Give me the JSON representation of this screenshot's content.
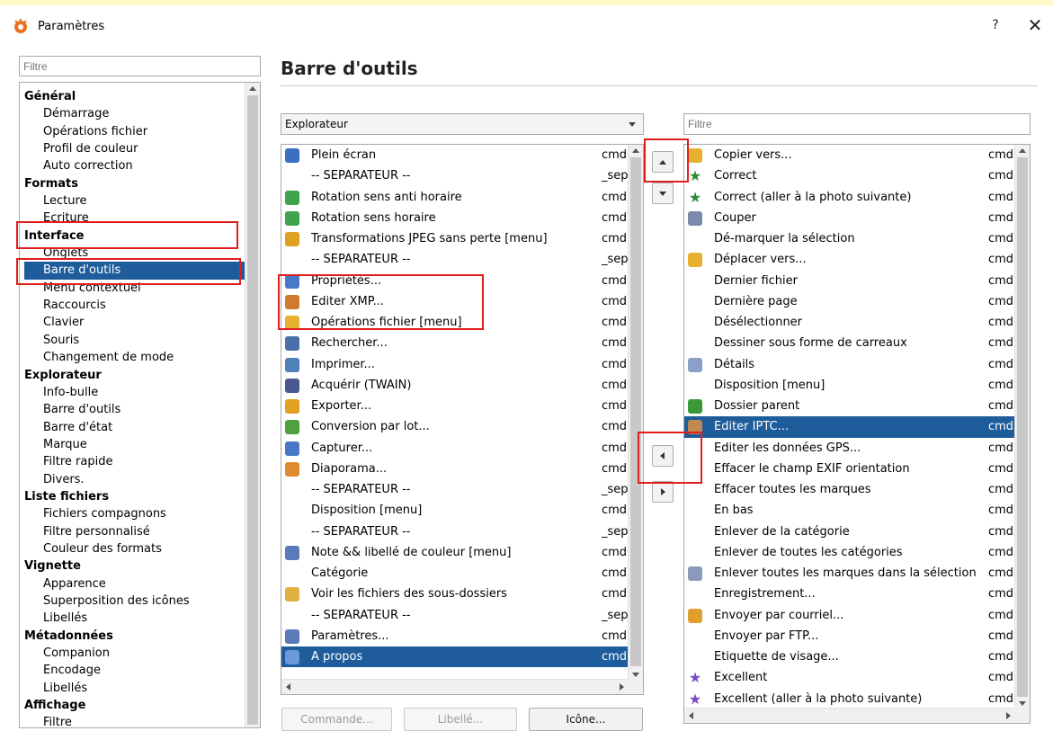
{
  "window": {
    "title": "Paramètres",
    "help": "?",
    "close": "✕"
  },
  "left_filter": {
    "placeholder": "Filtre"
  },
  "tree": [
    {
      "label": "Général",
      "level": 0
    },
    {
      "label": "Démarrage",
      "level": 1
    },
    {
      "label": "Opérations fichier",
      "level": 1
    },
    {
      "label": "Profil de couleur",
      "level": 1
    },
    {
      "label": "Auto correction",
      "level": 1
    },
    {
      "label": "Formats",
      "level": 0
    },
    {
      "label": "Lecture",
      "level": 1
    },
    {
      "label": "Ecriture",
      "level": 1
    },
    {
      "label": "Interface",
      "level": 0
    },
    {
      "label": "Onglets",
      "level": 1
    },
    {
      "label": "Barre d'outils",
      "level": 1,
      "selected": true
    },
    {
      "label": "Menu contextuel",
      "level": 1
    },
    {
      "label": "Raccourcis",
      "level": 1
    },
    {
      "label": "Clavier",
      "level": 1
    },
    {
      "label": "Souris",
      "level": 1
    },
    {
      "label": "Changement de mode",
      "level": 1
    },
    {
      "label": "Explorateur",
      "level": 0
    },
    {
      "label": "Info-bulle",
      "level": 1
    },
    {
      "label": "Barre d'outils",
      "level": 1
    },
    {
      "label": "Barre d'état",
      "level": 1
    },
    {
      "label": "Marque",
      "level": 1
    },
    {
      "label": "Filtre rapide",
      "level": 1
    },
    {
      "label": "Divers.",
      "level": 1
    },
    {
      "label": "Liste fichiers",
      "level": 0
    },
    {
      "label": "Fichiers compagnons",
      "level": 1
    },
    {
      "label": "Filtre personnalisé",
      "level": 1
    },
    {
      "label": "Couleur des formats",
      "level": 1
    },
    {
      "label": "Vignette",
      "level": 0
    },
    {
      "label": "Apparence",
      "level": 1
    },
    {
      "label": "Superposition des icônes",
      "level": 1
    },
    {
      "label": "Libellés",
      "level": 1
    },
    {
      "label": "Métadonnées",
      "level": 0
    },
    {
      "label": "Companion",
      "level": 1
    },
    {
      "label": "Encodage",
      "level": 1
    },
    {
      "label": "Libellés",
      "level": 1
    },
    {
      "label": "Affichage",
      "level": 0
    },
    {
      "label": "Filtre",
      "level": 1
    }
  ],
  "page_title": "Barre d'outils",
  "toolbar_combo": {
    "value": "Explorateur"
  },
  "right_filter": {
    "placeholder": "Filtre"
  },
  "left_list": [
    {
      "label": "Plein écran",
      "cmd": "cmd",
      "icon": "fullscreen-icon",
      "color": "#3a6fc4"
    },
    {
      "label": "-- SEPARATEUR --",
      "cmd": "_sep",
      "icon": ""
    },
    {
      "label": "Rotation sens anti horaire",
      "cmd": "cmd",
      "icon": "rotate-ccw-icon",
      "color": "#3fa34d"
    },
    {
      "label": "Rotation sens horaire",
      "cmd": "cmd",
      "icon": "rotate-cw-icon",
      "color": "#3fa34d"
    },
    {
      "label": "Transformations JPEG sans perte [menu]",
      "cmd": "cmd",
      "icon": "jpeg-transform-icon",
      "color": "#e0a020"
    },
    {
      "label": "-- SEPARATEUR --",
      "cmd": "_sep",
      "icon": ""
    },
    {
      "label": "Propriétés...",
      "cmd": "cmd",
      "icon": "properties-icon",
      "color": "#4a78c8"
    },
    {
      "label": "Editer XMP...",
      "cmd": "cmd",
      "icon": "edit-xmp-icon",
      "color": "#d07a30"
    },
    {
      "label": "Opérations fichier [menu]",
      "cmd": "cmd",
      "icon": "file-operations-icon",
      "color": "#e8b030"
    },
    {
      "label": "Rechercher...",
      "cmd": "cmd",
      "icon": "binoculars-icon",
      "color": "#4a6ea8"
    },
    {
      "label": "Imprimer...",
      "cmd": "cmd",
      "icon": "printer-icon",
      "color": "#5080b8"
    },
    {
      "label": "Acquérir (TWAIN)",
      "cmd": "cmd",
      "icon": "scanner-icon",
      "color": "#4a5a90"
    },
    {
      "label": "Exporter...",
      "cmd": "cmd",
      "icon": "export-icon",
      "color": "#e0a020"
    },
    {
      "label": "Conversion par lot...",
      "cmd": "cmd",
      "icon": "batch-convert-icon",
      "color": "#50a040"
    },
    {
      "label": "Capturer...",
      "cmd": "cmd",
      "icon": "camera-icon",
      "color": "#4a78c8"
    },
    {
      "label": "Diaporama...",
      "cmd": "cmd",
      "icon": "slideshow-icon",
      "color": "#e08a30"
    },
    {
      "label": "-- SEPARATEUR --",
      "cmd": "_sep",
      "icon": ""
    },
    {
      "label": "Disposition [menu]",
      "cmd": "cmd",
      "icon": ""
    },
    {
      "label": "-- SEPARATEUR --",
      "cmd": "_sep",
      "icon": ""
    },
    {
      "label": "Note && libellé de couleur [menu]",
      "cmd": "cmd",
      "icon": "rating-label-icon",
      "color": "#5a7ab8"
    },
    {
      "label": "Catégorie",
      "cmd": "cmd",
      "icon": ""
    },
    {
      "label": "Voir les fichiers des sous-dossiers",
      "cmd": "cmd",
      "icon": "subfolders-icon",
      "color": "#e0b040"
    },
    {
      "label": "-- SEPARATEUR --",
      "cmd": "_sep",
      "icon": ""
    },
    {
      "label": "Paramètres...",
      "cmd": "cmd",
      "icon": "gear-icon",
      "color": "#5a7ab8"
    },
    {
      "label": "A propos",
      "cmd": "cmd",
      "icon": "help-icon",
      "color": "#6a9ad8",
      "selected": true
    }
  ],
  "right_list": [
    {
      "label": "Copier vers...",
      "cmd": "cmd",
      "icon": "copy-to-folder-icon",
      "color": "#e8b030"
    },
    {
      "label": "Correct",
      "cmd": "cmd",
      "icon": "star-green-icon",
      "color": "#2e8b3a"
    },
    {
      "label": "Correct (aller à la photo suivante)",
      "cmd": "cmd",
      "icon": "star-green-next-icon",
      "color": "#2e8b3a"
    },
    {
      "label": "Couper",
      "cmd": "cmd",
      "icon": "scissors-icon",
      "color": "#7a8aa8"
    },
    {
      "label": "Dé-marquer la sélection",
      "cmd": "cmd",
      "icon": ""
    },
    {
      "label": "Déplacer vers...",
      "cmd": "cmd",
      "icon": "move-to-folder-icon",
      "color": "#e8b030"
    },
    {
      "label": "Dernier fichier",
      "cmd": "cmd",
      "icon": ""
    },
    {
      "label": "Dernière page",
      "cmd": "cmd",
      "icon": ""
    },
    {
      "label": "Désélectionner",
      "cmd": "cmd",
      "icon": ""
    },
    {
      "label": "Dessiner sous forme de carreaux",
      "cmd": "cmd",
      "icon": ""
    },
    {
      "label": "Détails",
      "cmd": "cmd",
      "icon": "details-view-icon",
      "color": "#8aa0c8"
    },
    {
      "label": "Disposition [menu]",
      "cmd": "cmd",
      "icon": ""
    },
    {
      "label": "Dossier parent",
      "cmd": "cmd",
      "icon": "up-arrow-green-icon",
      "color": "#3a9a3a"
    },
    {
      "label": "Editer IPTC...",
      "cmd": "cmd",
      "icon": "edit-iptc-icon",
      "color": "#c08a50",
      "selected": true
    },
    {
      "label": "Editer les données GPS...",
      "cmd": "cmd",
      "icon": ""
    },
    {
      "label": "Effacer le champ EXIF orientation",
      "cmd": "cmd",
      "icon": ""
    },
    {
      "label": "Effacer toutes les marques",
      "cmd": "cmd",
      "icon": ""
    },
    {
      "label": "En bas",
      "cmd": "cmd",
      "icon": ""
    },
    {
      "label": "Enlever de la catégorie",
      "cmd": "cmd",
      "icon": ""
    },
    {
      "label": "Enlever de toutes les catégories",
      "cmd": "cmd",
      "icon": ""
    },
    {
      "label": "Enlever toutes les marques dans la sélection",
      "cmd": "cmd",
      "icon": "clear-marks-icon",
      "color": "#8a9ab8"
    },
    {
      "label": "Enregistrement...",
      "cmd": "cmd",
      "icon": ""
    },
    {
      "label": "Envoyer par courriel...",
      "cmd": "cmd",
      "icon": "email-icon",
      "color": "#e0a030"
    },
    {
      "label": "Envoyer par FTP...",
      "cmd": "cmd",
      "icon": ""
    },
    {
      "label": "Etiquette de visage...",
      "cmd": "cmd",
      "icon": ""
    },
    {
      "label": "Excellent",
      "cmd": "cmd",
      "icon": "star-purple-icon",
      "color": "#7a4ac8"
    },
    {
      "label": "Excellent (aller à la photo suivante)",
      "cmd": "cmd",
      "icon": "star-purple-next-icon",
      "color": "#7a4ac8"
    }
  ],
  "buttons": {
    "command": "Commande...",
    "label": "Libellé...",
    "icon": "Icône..."
  },
  "colors": {
    "selection": "#1e5c9b",
    "highlight": "#e21d1d",
    "top_strip": "#fff8c9"
  }
}
